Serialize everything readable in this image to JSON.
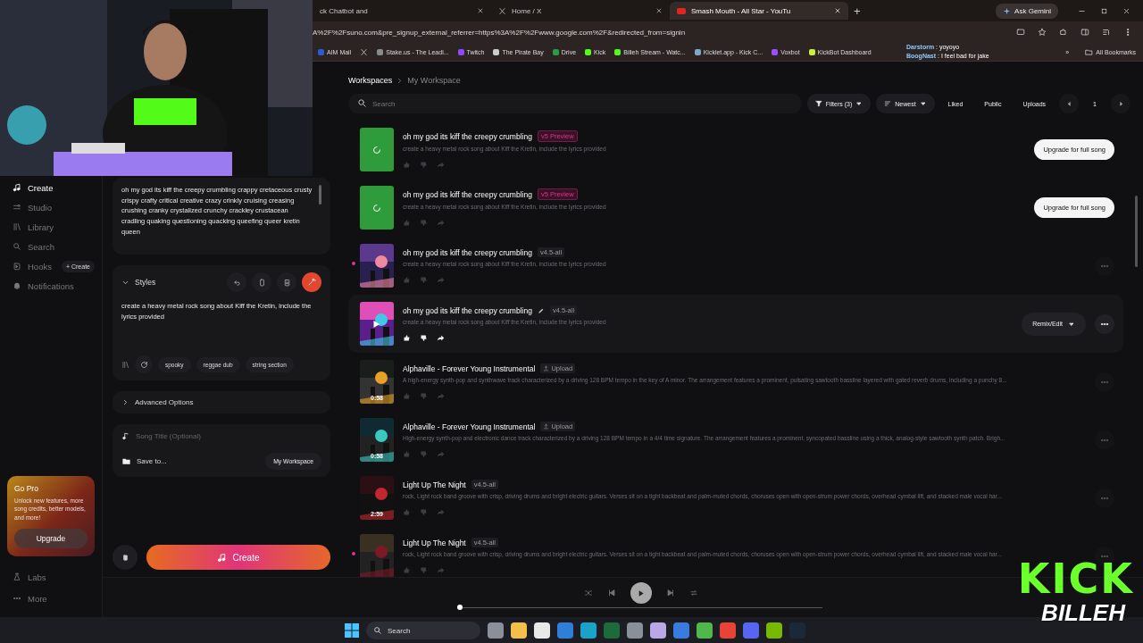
{
  "browser": {
    "tabs": [
      {
        "title": "ck Chatbot and",
        "selected": false
      },
      {
        "title": "Home / X",
        "selected": false
      },
      {
        "title": "Smash Mouth - All Star - YouTu",
        "selected": true
      }
    ],
    "new_tab": "+",
    "ask_gemini": "Ask Gemini",
    "url": "A%2F%2Fsuno.com&pre_signup_external_referrer=https%3A%2F%2Fwww.google.com%2F&redirected_from=signin",
    "bookmarks": [
      "AIM Mail",
      "Stake.us - The Leadi...",
      "Twitch",
      "The Pirate Bay",
      "Drive",
      "Kick",
      "Billeh Stream - Watc...",
      "Kicklet.app - Kick C...",
      "Voxbot",
      "KickBot Dashboard"
    ],
    "bookmarks_more": "»",
    "all_bookmarks": "All Bookmarks"
  },
  "chat_overlay": [
    {
      "user": "Darstorm",
      "message": ": yoyoyo"
    },
    {
      "user": "BoogNast",
      "message": ": I feel bad for jake"
    }
  ],
  "sidebar": {
    "items": [
      {
        "label": "Create",
        "selected": true
      },
      {
        "label": "Studio",
        "selected": false
      },
      {
        "label": "Library",
        "selected": false
      },
      {
        "label": "Search",
        "selected": false
      },
      {
        "label": "Hooks",
        "selected": false,
        "badge": "+ Create"
      },
      {
        "label": "Notifications",
        "selected": false
      }
    ],
    "promo": {
      "title": "Go Pro",
      "text": "Unlock new features, more song credits, better models, and more!",
      "button": "Upgrade"
    },
    "bottom_items": [
      {
        "label": "Labs"
      },
      {
        "label": "More"
      }
    ]
  },
  "create_panel": {
    "lyrics": "oh my god its kiff the creepy crumbling crappy cretaceous crusty crispy crafty critical creative crazy crinkly cruising creasing crushing cranky crystalized crunchy crackley crustacean cradling quaking questioning quacking queefing queer kretin queen",
    "styles": {
      "label": "Styles",
      "text": "create a heavy metal rock song about Kiff the Kretin, include the lyrics provided",
      "chips": [
        "spooky",
        "reggae dub",
        "string section"
      ]
    },
    "advanced": {
      "label": "Advanced Options",
      "expanded": false
    },
    "song_title": {
      "placeholder": "Song Title (Optional)"
    },
    "save_to": {
      "label": "Save to...",
      "value": "My Workspace"
    },
    "create_button": "Create"
  },
  "main": {
    "breadcrumbs": [
      "Workspaces",
      "My Workspace"
    ],
    "search": {
      "placeholder": "Search"
    },
    "filters": [
      {
        "label": "Filters (3)",
        "kind": "dropdown"
      },
      {
        "label": "Newest",
        "kind": "dropdown"
      },
      {
        "label": "Liked",
        "kind": "plain"
      },
      {
        "label": "Public",
        "kind": "plain"
      },
      {
        "label": "Uploads",
        "kind": "plain"
      }
    ],
    "page": "1",
    "songs": [
      {
        "title": "oh my god its kiff the creepy crumbling",
        "tag": {
          "text": "v5 Preview",
          "kind": "preview"
        },
        "description": "create a heavy metal rock song about Kiff the Kretin, include the lyrics provided",
        "loading": true,
        "action": {
          "kind": "upgrade",
          "label": "Upgrade for full song"
        },
        "selected": false,
        "dot": false
      },
      {
        "title": "oh my god its kiff the creepy crumbling",
        "tag": {
          "text": "v5 Preview",
          "kind": "preview"
        },
        "description": "create a heavy metal rock song about Kiff the Kretin, include the lyrics provided",
        "loading": true,
        "action": {
          "kind": "upgrade",
          "label": "Upgrade for full song"
        },
        "selected": false,
        "dot": false
      },
      {
        "title": "oh my god its kiff the creepy crumbling",
        "tag": {
          "text": "v4.5-all",
          "kind": "version"
        },
        "description": "create a heavy metal rock song about Kiff the Kretin, include the lyrics provided",
        "loading": false,
        "action": {
          "kind": "more"
        },
        "selected": false,
        "dot": true
      },
      {
        "title": "oh my god its kiff the creepy crumbling",
        "tag": {
          "text": "v4.5-all",
          "kind": "version"
        },
        "description": "create a heavy metal rock song about Kiff the Kretin, include the lyrics provided",
        "loading": false,
        "action": {
          "kind": "remix",
          "label": "Remix/Edit"
        },
        "selected": true,
        "dot": false,
        "editable": true
      },
      {
        "title": "Alphaville - Forever Young Instrumental",
        "tag": {
          "text": "Upload",
          "kind": "upload"
        },
        "description": "A high-energy synth-pop and synthwave track characterized by a driving 128 BPM tempo in the key of A minor. The arrangement features a prominent, pulsating sawtooth bassline layered with gated reverb drums, including a punchy 8...",
        "loading": false,
        "duration": "0:58",
        "action": {
          "kind": "more"
        },
        "selected": false,
        "dot": false
      },
      {
        "title": "Alphaville - Forever Young Instrumental",
        "tag": {
          "text": "Upload",
          "kind": "upload"
        },
        "description": "High-energy synth-pop and electronic dance track characterized by a driving 128 BPM tempo in a 4/4 time signature. The arrangement features a prominent, syncopated bassline using a thick, analog-style sawtooth synth patch. Brigh...",
        "loading": false,
        "duration": "0:58",
        "action": {
          "kind": "more"
        },
        "selected": false,
        "dot": false
      },
      {
        "title": "Light Up The Night",
        "tag": {
          "text": "v4.5-all",
          "kind": "version"
        },
        "description": "rock, Light rock band groove with crisp, driving drums and bright electric guitars. Verses sit on a tight backbeat and palm-muted chords, choruses open with open-strum power chords, overhead cymbal lift, and stacked male vocal har...",
        "loading": false,
        "duration": "2:59",
        "action": {
          "kind": "more"
        },
        "selected": false,
        "dot": false
      },
      {
        "title": "Light Up The Night",
        "tag": {
          "text": "v4.5-all",
          "kind": "version"
        },
        "description": "rock, Light rock band groove with crisp, driving drums and bright electric guitars. Verses sit on a tight backbeat and palm-muted chords, choruses open with open-strum power chords, overhead cymbal lift, and stacked male vocal har...",
        "loading": false,
        "action": {
          "kind": "more"
        },
        "selected": false,
        "dot": true
      }
    ]
  },
  "player": {
    "playing": false,
    "level": 0
  },
  "taskbar": {
    "search": "Search"
  },
  "logo": {
    "top": "KICK",
    "bottom": "BILLEH"
  }
}
